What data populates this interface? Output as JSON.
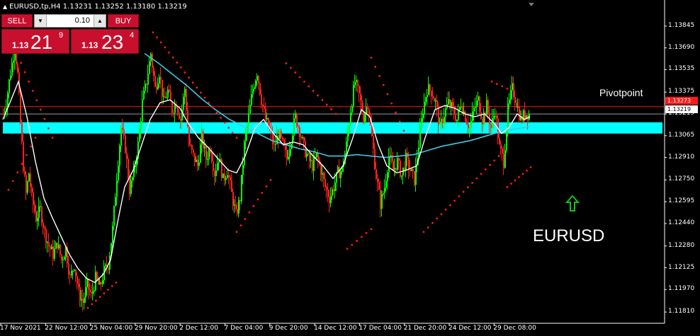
{
  "header": {
    "text": "EURUSD,tp,H4  1.13231 1.13252 1.13180 1.13219"
  },
  "trade_panel": {
    "sell_label": "SELL",
    "buy_label": "BUY",
    "lot_value": "0.10",
    "bid": {
      "prefix": "1.13",
      "big": "21",
      "sup": "9"
    },
    "ask": {
      "prefix": "1.13",
      "big": "23",
      "sup": "4"
    }
  },
  "annotations": {
    "pivot_label": "Pivotpoint",
    "symbol_label": "EURUSD",
    "arrow_color": "#19c019"
  },
  "price_boxes": {
    "pivot": "1.13273",
    "bid": "1.13219"
  },
  "chart_data": {
    "type": "candlestick",
    "symbol": "EURUSD",
    "timeframe": "H4",
    "y_ticks": [
      "1.13845",
      "1.13690",
      "1.13535",
      "1.13375",
      "1.13219",
      "1.13065",
      "1.12910",
      "1.12750",
      "1.12595",
      "1.12440",
      "1.12280",
      "1.12125",
      "1.11970",
      "1.11810"
    ],
    "ylim": [
      1.1174,
      1.1398
    ],
    "x_ticks": [
      "17 Nov 2021",
      "22 Nov 12:00",
      "25 Nov 04:00",
      "29 Nov 20:00",
      "2 Dec 12:00",
      "7 Dec 04:00",
      "9 Dec 20:00",
      "14 Dec 12:00",
      "17 Dec 04:00",
      "21 Dec 20:00",
      "24 Dec 12:00",
      "29 Dec 08:00"
    ],
    "pivot_level": 1.13273,
    "zone": {
      "low": 1.1308,
      "high": 1.1316
    },
    "bid_level": 1.13219,
    "colors": {
      "bull": "#00ff00",
      "bear": "#ff2020",
      "ma_fast": "#ffffff",
      "ma_slow": "#3ec9e6",
      "zone": "#00ffff",
      "pivot": "#ff0000",
      "sar": "#ff1a1a"
    },
    "close_path": [
      [
        0,
        1.1322
      ],
      [
        4,
        1.133
      ],
      [
        8,
        1.1345
      ],
      [
        12,
        1.1358
      ],
      [
        16,
        1.137
      ],
      [
        20,
        1.135
      ],
      [
        24,
        1.1315
      ],
      [
        28,
        1.1285
      ],
      [
        32,
        1.1265
      ],
      [
        36,
        1.128
      ],
      [
        40,
        1.1262
      ],
      [
        46,
        1.1248
      ],
      [
        52,
        1.1254
      ],
      [
        58,
        1.1238
      ],
      [
        64,
        1.1228
      ],
      [
        70,
        1.1222
      ],
      [
        76,
        1.123
      ],
      [
        82,
        1.1218
      ],
      [
        88,
        1.1226
      ],
      [
        94,
        1.1205
      ],
      [
        100,
        1.1215
      ],
      [
        106,
        1.1195
      ],
      [
        112,
        1.1188
      ],
      [
        118,
        1.12
      ],
      [
        124,
        1.1192
      ],
      [
        130,
        1.1205
      ],
      [
        136,
        1.1198
      ],
      [
        142,
        1.121
      ],
      [
        148,
        1.1215
      ],
      [
        154,
        1.124
      ],
      [
        160,
        1.1278
      ],
      [
        166,
        1.1312
      ],
      [
        172,
        1.1298
      ],
      [
        178,
        1.1268
      ],
      [
        184,
        1.128
      ],
      [
        190,
        1.13
      ],
      [
        196,
        1.133
      ],
      [
        202,
        1.1345
      ],
      [
        208,
        1.1365
      ],
      [
        214,
        1.134
      ],
      [
        220,
        1.1352
      ],
      [
        226,
        1.133
      ],
      [
        232,
        1.1338
      ],
      [
        238,
        1.1325
      ],
      [
        244,
        1.133
      ],
      [
        250,
        1.1318
      ],
      [
        256,
        1.134
      ],
      [
        262,
        1.13
      ],
      [
        268,
        1.1292
      ],
      [
        274,
        1.1285
      ],
      [
        280,
        1.1305
      ],
      [
        286,
        1.129
      ],
      [
        292,
        1.1298
      ],
      [
        298,
        1.128
      ],
      [
        304,
        1.1292
      ],
      [
        310,
        1.1275
      ],
      [
        316,
        1.1282
      ],
      [
        322,
        1.1265
      ],
      [
        328,
        1.125
      ],
      [
        334,
        1.1262
      ],
      [
        340,
        1.13
      ],
      [
        346,
        1.132
      ],
      [
        352,
        1.134
      ],
      [
        358,
        1.1352
      ],
      [
        364,
        1.1332
      ],
      [
        370,
        1.1318
      ],
      [
        376,
        1.131
      ],
      [
        382,
        1.1298
      ],
      [
        388,
        1.1308
      ],
      [
        394,
        1.13
      ],
      [
        400,
        1.129
      ],
      [
        406,
        1.1305
      ],
      [
        412,
        1.132
      ],
      [
        418,
        1.131
      ],
      [
        424,
        1.1298
      ],
      [
        430,
        1.129
      ],
      [
        436,
        1.1285
      ],
      [
        442,
        1.1292
      ],
      [
        448,
        1.1282
      ],
      [
        454,
        1.127
      ],
      [
        460,
        1.1262
      ],
      [
        466,
        1.127
      ],
      [
        472,
        1.128
      ],
      [
        478,
        1.1282
      ],
      [
        484,
        1.13
      ],
      [
        490,
        1.1325
      ],
      [
        496,
        1.1345
      ],
      [
        502,
        1.1335
      ],
      [
        508,
        1.132
      ],
      [
        514,
        1.133
      ],
      [
        520,
        1.1305
      ],
      [
        526,
        1.1278
      ],
      [
        532,
        1.1258
      ],
      [
        538,
        1.127
      ],
      [
        544,
        1.1292
      ],
      [
        550,
        1.1282
      ],
      [
        556,
        1.1288
      ],
      [
        562,
        1.1278
      ],
      [
        568,
        1.129
      ],
      [
        574,
        1.1282
      ],
      [
        580,
        1.1275
      ],
      [
        586,
        1.13
      ],
      [
        592,
        1.1325
      ],
      [
        598,
        1.134
      ],
      [
        604,
        1.1338
      ],
      [
        610,
        1.133
      ],
      [
        616,
        1.1312
      ],
      [
        622,
        1.1322
      ],
      [
        628,
        1.133
      ],
      [
        634,
        1.1325
      ],
      [
        640,
        1.1318
      ],
      [
        646,
        1.133
      ],
      [
        652,
        1.132
      ],
      [
        658,
        1.1312
      ],
      [
        664,
        1.1325
      ],
      [
        670,
        1.1332
      ],
      [
        676,
        1.1318
      ],
      [
        682,
        1.1328
      ],
      [
        688,
        1.1312
      ],
      [
        694,
        1.1325
      ],
      [
        700,
        1.1298
      ],
      [
        706,
        1.1288
      ],
      [
        712,
        1.1325
      ],
      [
        718,
        1.134
      ],
      [
        724,
        1.133
      ],
      [
        730,
        1.1318
      ],
      [
        736,
        1.1322
      ],
      [
        742,
        1.1322
      ]
    ],
    "ma_fast": [
      [
        0,
        1.1318
      ],
      [
        10,
        1.133
      ],
      [
        22,
        1.1345
      ],
      [
        34,
        1.132
      ],
      [
        46,
        1.1288
      ],
      [
        58,
        1.1262
      ],
      [
        70,
        1.1248
      ],
      [
        82,
        1.1235
      ],
      [
        94,
        1.1222
      ],
      [
        106,
        1.1212
      ],
      [
        118,
        1.1205
      ],
      [
        130,
        1.1202
      ],
      [
        142,
        1.1208
      ],
      [
        152,
        1.1218
      ],
      [
        162,
        1.1245
      ],
      [
        172,
        1.127
      ],
      [
        184,
        1.1282
      ],
      [
        196,
        1.13
      ],
      [
        208,
        1.1318
      ],
      [
        222,
        1.133
      ],
      [
        236,
        1.1332
      ],
      [
        250,
        1.1326
      ],
      [
        262,
        1.1315
      ],
      [
        276,
        1.1305
      ],
      [
        290,
        1.1298
      ],
      [
        304,
        1.129
      ],
      [
        318,
        1.1282
      ],
      [
        330,
        1.128
      ],
      [
        342,
        1.1292
      ],
      [
        356,
        1.1312
      ],
      [
        368,
        1.1318
      ],
      [
        382,
        1.1308
      ],
      [
        396,
        1.13
      ],
      [
        410,
        1.1302
      ],
      [
        424,
        1.13
      ],
      [
        438,
        1.1292
      ],
      [
        452,
        1.1285
      ],
      [
        466,
        1.1276
      ],
      [
        480,
        1.1285
      ],
      [
        494,
        1.1305
      ],
      [
        506,
        1.1325
      ],
      [
        518,
        1.132
      ],
      [
        530,
        1.13
      ],
      [
        542,
        1.1285
      ],
      [
        556,
        1.128
      ],
      [
        570,
        1.1282
      ],
      [
        584,
        1.1285
      ],
      [
        596,
        1.1305
      ],
      [
        610,
        1.1325
      ],
      [
        624,
        1.1328
      ],
      [
        638,
        1.1326
      ],
      [
        652,
        1.1322
      ],
      [
        666,
        1.132
      ],
      [
        680,
        1.1322
      ],
      [
        694,
        1.1315
      ],
      [
        704,
        1.1308
      ],
      [
        714,
        1.1312
      ],
      [
        726,
        1.1322
      ],
      [
        736,
        1.1318
      ],
      [
        744,
        1.132
      ]
    ],
    "ma_slow": [
      [
        200,
        1.1365
      ],
      [
        220,
        1.1358
      ],
      [
        240,
        1.135
      ],
      [
        260,
        1.1342
      ],
      [
        280,
        1.1333
      ],
      [
        300,
        1.1325
      ],
      [
        320,
        1.1318
      ],
      [
        340,
        1.1313
      ],
      [
        360,
        1.1308
      ],
      [
        380,
        1.1303
      ],
      [
        400,
        1.13
      ],
      [
        420,
        1.1297
      ],
      [
        440,
        1.1295
      ],
      [
        460,
        1.1292
      ],
      [
        480,
        1.1292
      ],
      [
        500,
        1.1293
      ],
      [
        520,
        1.1292
      ],
      [
        540,
        1.1291
      ],
      [
        560,
        1.1292
      ],
      [
        580,
        1.1293
      ],
      [
        600,
        1.1296
      ],
      [
        620,
        1.1299
      ],
      [
        640,
        1.1301
      ],
      [
        660,
        1.1303
      ],
      [
        680,
        1.1306
      ],
      [
        700,
        1.1309
      ],
      [
        720,
        1.1311
      ],
      [
        744,
        1.1313
      ]
    ],
    "sar_segments": [
      {
        "from": [
          20,
          1.1365
        ],
        "to": [
          70,
          1.1305
        ],
        "count": 10
      },
      {
        "from": [
          8,
          1.1268
        ],
        "to": [
          46,
          1.1305
        ],
        "count": 7
      },
      {
        "from": [
          120,
          1.1184
        ],
        "to": [
          160,
          1.1202
        ],
        "count": 8
      },
      {
        "from": [
          212,
          1.138
        ],
        "to": [
          330,
          1.1305
        ],
        "count": 22
      },
      {
        "from": [
          330,
          1.1238
        ],
        "to": [
          378,
          1.1275
        ],
        "count": 9
      },
      {
        "from": [
          400,
          1.1358
        ],
        "to": [
          470,
          1.1322
        ],
        "count": 12
      },
      {
        "from": [
          486,
          1.1226
        ],
        "to": [
          520,
          1.124
        ],
        "count": 6
      },
      {
        "from": [
          520,
          1.1362
        ],
        "to": [
          566,
          1.131
        ],
        "count": 9
      },
      {
        "from": [
          594,
          1.1238
        ],
        "to": [
          700,
          1.1292
        ],
        "count": 18
      },
      {
        "from": [
          690,
          1.1345
        ],
        "to": [
          712,
          1.134
        ],
        "count": 4
      },
      {
        "from": [
          712,
          1.127
        ],
        "to": [
          745,
          1.1284
        ],
        "count": 7
      }
    ]
  }
}
